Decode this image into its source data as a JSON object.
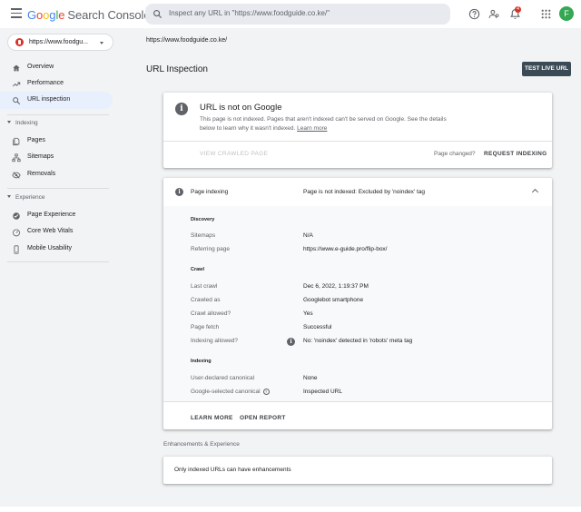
{
  "header": {
    "logo_google": "Google",
    "logo_product": "Search Console",
    "search_placeholder": "Inspect any URL in \"https://www.foodguide.co.ke/\"",
    "notification_count": "4",
    "avatar_letter": "F"
  },
  "sidebar": {
    "property": "https://www.foodgu...",
    "items_top": [
      {
        "label": "Overview",
        "icon": "home-icon"
      },
      {
        "label": "Performance",
        "icon": "trending-icon"
      },
      {
        "label": "URL inspection",
        "icon": "search-icon"
      }
    ],
    "indexing_label": "Indexing",
    "indexing_items": [
      {
        "label": "Pages",
        "icon": "pages-icon"
      },
      {
        "label": "Sitemaps",
        "icon": "sitemap-icon"
      },
      {
        "label": "Removals",
        "icon": "removals-icon"
      }
    ],
    "experience_label": "Experience",
    "experience_items": [
      {
        "label": "Page Experience",
        "icon": "page-experience-icon"
      },
      {
        "label": "Core Web Vitals",
        "icon": "speed-icon"
      },
      {
        "label": "Mobile Usability",
        "icon": "phone-icon"
      }
    ]
  },
  "main": {
    "url": "https://www.foodguide.co.ke/",
    "title": "URL Inspection",
    "test_live_button": "TEST LIVE URL"
  },
  "status_card": {
    "title": "URL is not on Google",
    "desc": "This page is not indexed. Pages that aren't indexed can't be served on Google. See the details below to learn why it wasn't indexed.",
    "learn_more": "Learn more",
    "view_crawled": "VIEW CRAWLED PAGE",
    "page_changed": "Page changed?",
    "request_indexing": "REQUEST INDEXING"
  },
  "indexing_card": {
    "header_label": "Page indexing",
    "header_value": "Page is not indexed: Excluded by 'noindex' tag",
    "discovery": {
      "title": "Discovery",
      "rows": [
        {
          "label": "Sitemaps",
          "value": "N/A"
        },
        {
          "label": "Referring page",
          "value": "https://www.e-guide.pro/flip-box/"
        }
      ]
    },
    "crawl": {
      "title": "Crawl",
      "rows": [
        {
          "label": "Last crawl",
          "value": "Dec 6, 2022, 1:19:37 PM"
        },
        {
          "label": "Crawled as",
          "value": "Googlebot smartphone"
        },
        {
          "label": "Crawl allowed?",
          "value": "Yes"
        },
        {
          "label": "Page fetch",
          "value": "Successful"
        },
        {
          "label": "Indexing allowed?",
          "value": "No: 'noindex' detected in 'robots' meta tag"
        }
      ]
    },
    "indexing": {
      "title": "Indexing",
      "rows": [
        {
          "label": "User-declared canonical",
          "value": "None"
        },
        {
          "label": "Google-selected canonical",
          "value": "Inspected URL"
        }
      ]
    },
    "learn_more": "LEARN MORE",
    "open_report": "OPEN REPORT"
  },
  "enhancements": {
    "title": "Enhancements & Experience",
    "message": "Only indexed URLs can have enhancements"
  }
}
